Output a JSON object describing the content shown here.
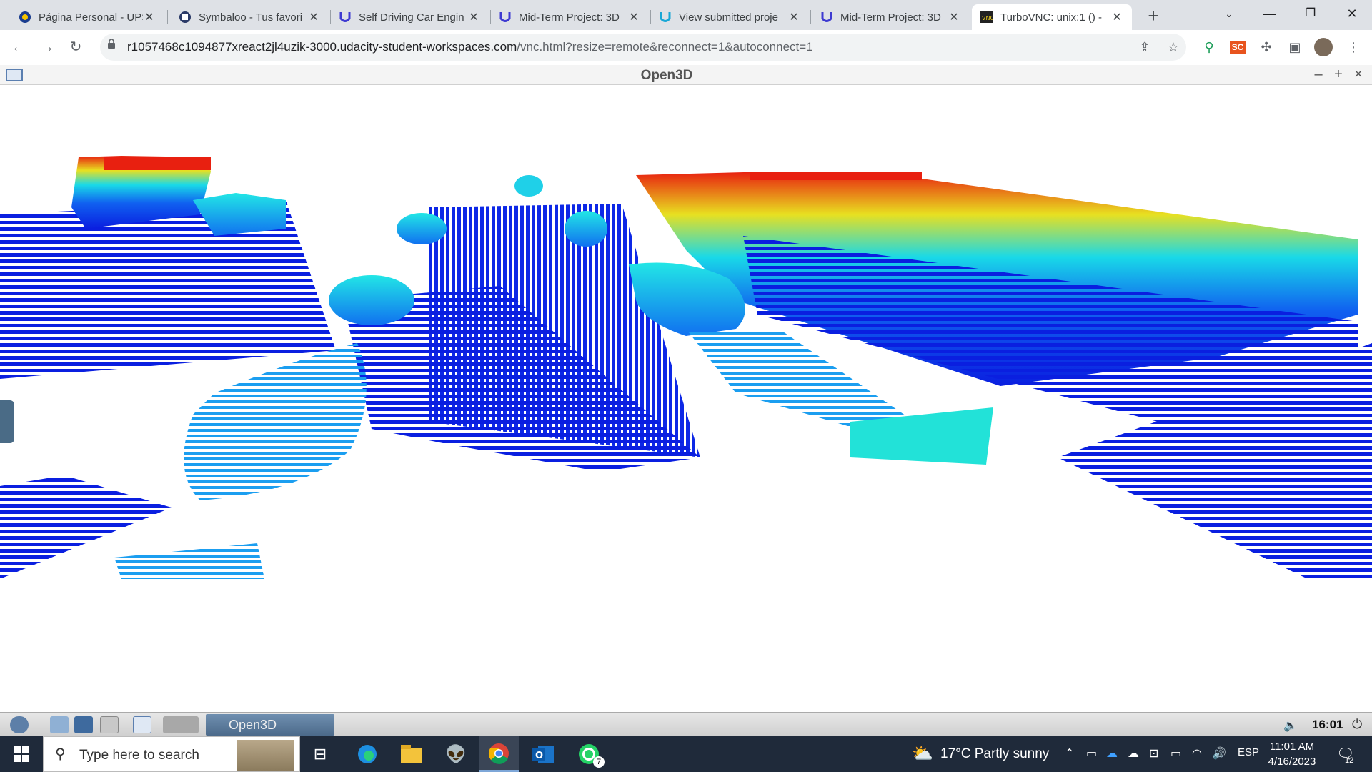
{
  "browser": {
    "tabs": [
      {
        "title": "Página Personal - UPS",
        "icon": "ups-favicon"
      },
      {
        "title": "Symbaloo - Tus favori",
        "icon": "symbaloo-favicon"
      },
      {
        "title": "Self Driving Car Engin",
        "icon": "udacity-favicon"
      },
      {
        "title": "Mid-Term Project: 3D",
        "icon": "udacity-favicon"
      },
      {
        "title": "View submitted proje",
        "icon": "udacity-favicon"
      },
      {
        "title": "Mid-Term Project: 3D",
        "icon": "udacity-favicon"
      },
      {
        "title": "TurboVNC: unix:1 () -",
        "icon": "vnc-favicon",
        "active": true
      }
    ],
    "url_host": "r1057468c1094877xreact2jl4uzik-3000.udacity-student-workspaces.com",
    "url_path": "/vnc.html?resize=remote&reconnect=1&autoconnect=1"
  },
  "open3d": {
    "window_title": "Open3D"
  },
  "vnc_panel": {
    "task_label": "Open3D",
    "clock": "16:01"
  },
  "taskbar": {
    "search_placeholder": "Type here to search",
    "weather": "17°C  Partly sunny",
    "language": "ESP",
    "time": "11:01 AM",
    "date": "4/16/2023",
    "whatsapp_badge": "7",
    "notification_count": "12"
  },
  "colors": {
    "point_low": "#0a1fe0",
    "point_mid": "#19d9e8",
    "point_high": "#e82010",
    "taskbar_bg": "#1f2a3a"
  }
}
